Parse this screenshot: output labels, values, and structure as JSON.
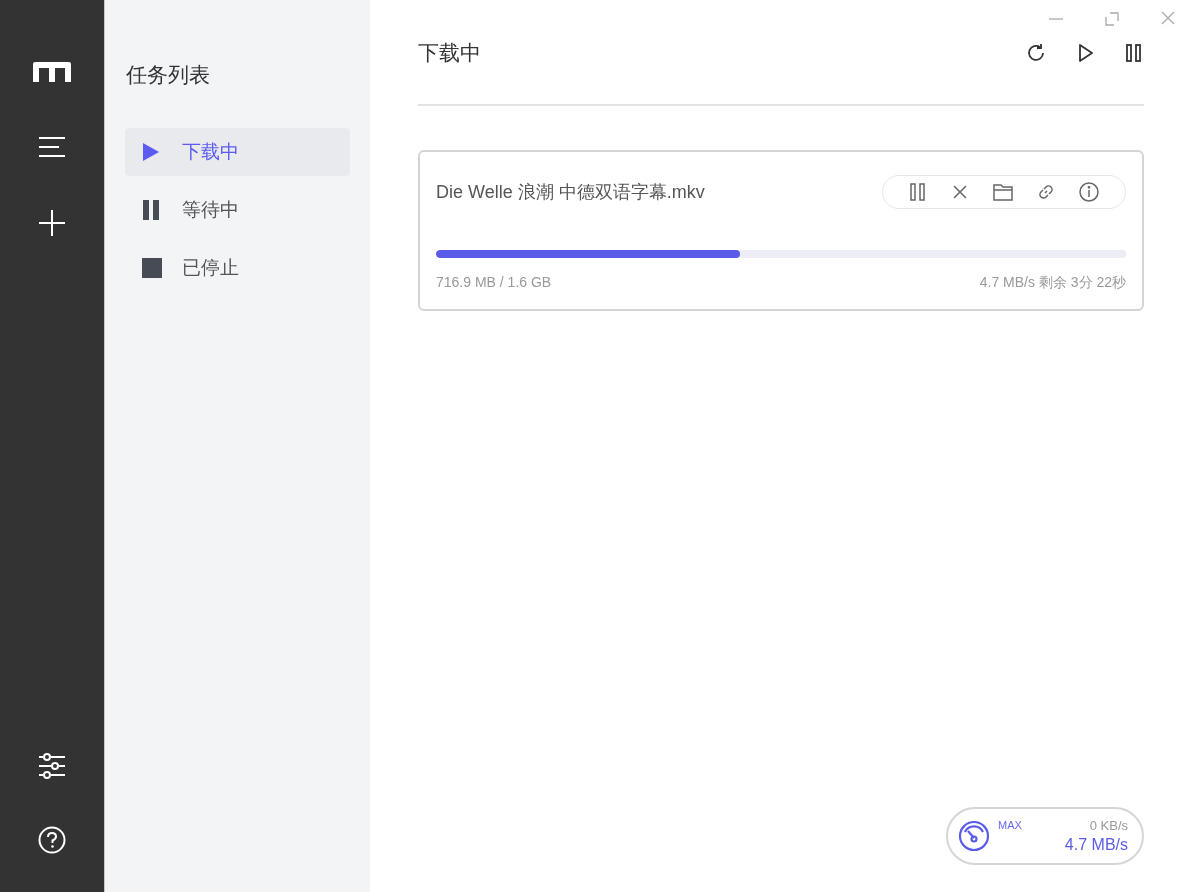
{
  "sidebar": {
    "title": "任务列表",
    "items": [
      {
        "kind": "play",
        "label": "下载中",
        "selected": true
      },
      {
        "kind": "pause",
        "label": "等待中",
        "selected": false
      },
      {
        "kind": "stop",
        "label": "已停止",
        "selected": false
      }
    ]
  },
  "main": {
    "title": "下载中"
  },
  "tasks": [
    {
      "name": "Die Welle 浪潮 中德双语字幕.mkv",
      "level": 0.44,
      "progress": "716.9 MB / 1.6 GB",
      "speed": "4.7 MB/s 剩余 3分 22秒"
    }
  ],
  "speed_meter": {
    "label": "MAX",
    "upload": "0 KB/s",
    "download": "4.7 MB/s"
  }
}
